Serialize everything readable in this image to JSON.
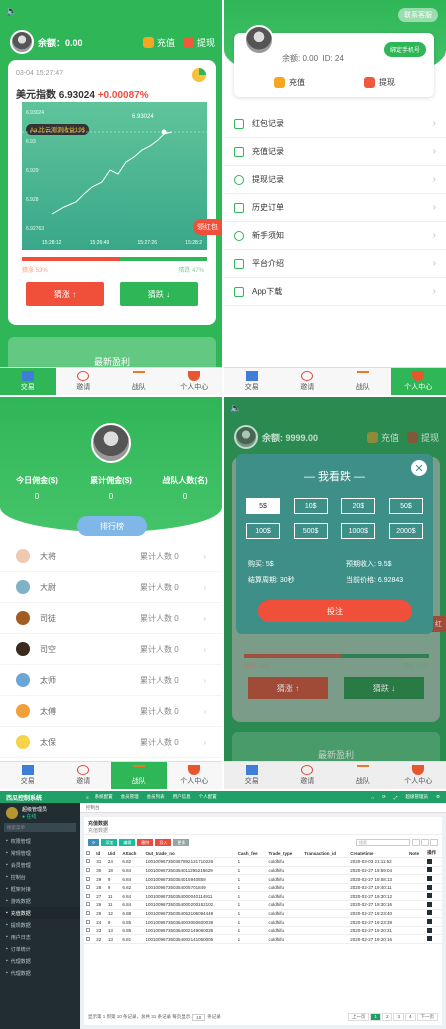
{
  "trade": {
    "balance": "余额：0.00",
    "recharge": "充值",
    "withdraw": "提现",
    "time": "03-04 15:27:47",
    "index_name": "美元指数",
    "index_value": "6.93024",
    "index_change": "+0.00087%",
    "chart_user_tag": "Aa.比云测测收益19$",
    "chart_price": "6.93024",
    "y_ticks": [
      "6.93024",
      "6.93",
      "6.929",
      "6.928",
      "6.92763"
    ],
    "x_ticks": [
      "15:28:12",
      "15:26:49",
      "15:27:26",
      "15:28:2"
    ],
    "side_tab": "领红包",
    "up_pct": "猜涨 53%",
    "down_pct": "猜跌 47%",
    "buy_up": "猜涨 ↑",
    "buy_down": "猜跌 ↓",
    "latest": "最新盈利"
  },
  "tabs": [
    "交易",
    "邀请",
    "战队",
    "个人中心"
  ],
  "profile": {
    "contact": "联系客服",
    "balance": "余额: 0.00",
    "uid": "ID: 24",
    "bind_phone": "绑定手机号",
    "recharge": "充值",
    "withdraw": "提现",
    "menu": [
      "红包记录",
      "充值记录",
      "提现记录",
      "历史订单",
      "新手须知",
      "平台介绍",
      "App下载"
    ]
  },
  "team": {
    "stats": [
      {
        "label": "今日佣金($)",
        "value": "0"
      },
      {
        "label": "累计佣金($)",
        "value": "0"
      },
      {
        "label": "战队人数(名)",
        "value": "0"
      }
    ],
    "rank_btn": "排行榜",
    "ranks": [
      "大将",
      "大尉",
      "司徒",
      "司空",
      "太师",
      "太傅",
      "太保"
    ],
    "rank_count": "累计人数 0"
  },
  "dialog": {
    "balance": "余额: 9999.00",
    "recharge": "充值",
    "withdraw": "提现",
    "title": "我看跌",
    "amounts": [
      "5$",
      "10$",
      "20$",
      "50$",
      "100$",
      "500$",
      "1000$",
      "2000$"
    ],
    "buy": "购买: 5$",
    "expect": "预期收入: 9.5$",
    "period": "结算周期: 30秒",
    "price": "当前价格: 6.92843",
    "submit": "投注",
    "up_pct": "猜涨 53%",
    "down_pct": "猜跌 47%",
    "buy_up": "猜涨 ↑",
    "buy_down": "猜跌 ↓",
    "latest": "最新盈利",
    "side_tab": "红"
  },
  "admin": {
    "logo": "西瓜控制系统",
    "user": "超级管理员",
    "status": "● 在线",
    "search_ph": "搜索菜单",
    "menu": [
      "权限管理",
      "常规管理",
      "会员管理",
      "控制台",
      "框架对接",
      "游戏数据",
      "充值数据",
      "提现数据",
      "用户日志",
      "订单统计",
      "代理数据",
      "代理数据"
    ],
    "topnav": [
      "系统配置",
      "会员管理",
      "会员列表",
      "用户信息",
      "个人配置"
    ],
    "admin_name": "超级管理员",
    "breadcrumb": "控制台",
    "page_title": "充值数据",
    "page_sub": "充值数据",
    "toolbar": [
      "添加",
      "编辑",
      "删除",
      "导入",
      "更多"
    ],
    "search_box": "搜索",
    "columns": [
      "Id",
      "Uid",
      "Attach",
      "Out_trade_no",
      "Cash_fee",
      "Trade_type",
      "Transaction_id",
      "Createtime",
      "Note",
      "操作"
    ],
    "rows": [
      [
        "31",
        "24",
        "6.82",
        "100100967350367892131710226",
        "1",
        "coldhifu",
        "",
        "2020-03-03 21:11:52",
        ""
      ],
      [
        "30",
        "18",
        "6.84",
        "100100967350354011295215629",
        "1",
        "coldhifu",
        "",
        "2020-02-27 19:59:04",
        ""
      ],
      [
        "29",
        "9",
        "6.84",
        "100100967350354015940859",
        "1",
        "coldhifu",
        "",
        "2020-02-27 19:58:13",
        ""
      ],
      [
        "28",
        "9",
        "6.82",
        "100100967350354005701849",
        "1",
        "coldhifu",
        "",
        "2020-02-27 19:40:11",
        ""
      ],
      [
        "27",
        "11",
        "6.84",
        "100100967350354000040114911",
        "1",
        "coldhifu",
        "",
        "2020-02-27 19:30:12",
        ""
      ],
      [
        "26",
        "11",
        "6.84",
        "100100967350354000200152102",
        "1",
        "coldhifu",
        "",
        "2020-02-27 19:30:16",
        ""
      ],
      [
        "25",
        "12",
        "6.88",
        "100100967350354053105094448",
        "1",
        "coldhifu",
        "",
        "2020-02-27 19:23:40",
        ""
      ],
      [
        "24",
        "9",
        "6.85",
        "100100967350354003050600039",
        "1",
        "coldhifu",
        "",
        "2020-02-27 19:23:39",
        ""
      ],
      [
        "23",
        "13",
        "6.86",
        "100100967350354002149060035",
        "1",
        "coldhifu",
        "",
        "2020-02-27 19:20:31",
        ""
      ],
      [
        "22",
        "13",
        "6.81",
        "100100967350354002141050005",
        "1",
        "coldhifu",
        "",
        "2020-02-27 19:20:16",
        ""
      ]
    ],
    "footer": "显示第 1 到第 10 条记录，总共 31 条记录 每页显示",
    "per_page": "10",
    "footer_tail": "条记录",
    "pages": [
      "上一页",
      "1",
      "2",
      "3",
      "4",
      "下一页"
    ]
  },
  "colors": {
    "green": "#2fb657",
    "red": "#f24d3b",
    "dark": "#222d32",
    "teal": "#3d8f88"
  }
}
